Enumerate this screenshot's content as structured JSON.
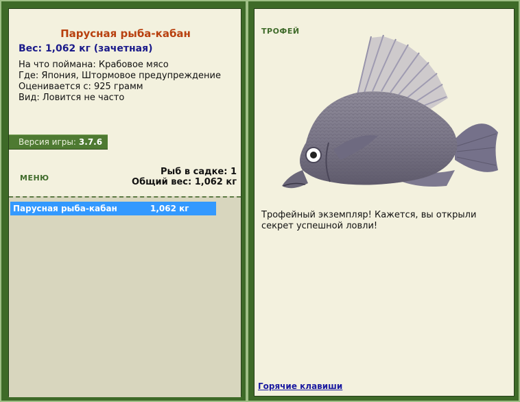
{
  "fish": {
    "title": "Парусная рыба-кабан",
    "weight_line": "Вес: 1,062 кг (зачетная)",
    "bait": "На что поймана: Крабовое мясо",
    "location": "Где: Япония, Штормовое предупреждение",
    "rated_from": "Оценивается с: 925 грамм",
    "species_note": "Вид: Ловится не часто"
  },
  "version": {
    "label": "Версия игры:",
    "value": "3.7.6"
  },
  "menu": {
    "label": "МЕНЮ"
  },
  "stats": {
    "fish_count": "Рыб в садке: 1",
    "total_weight": "Общий вес: 1,062 кг"
  },
  "keepnet": {
    "items": [
      {
        "name": "Парусная рыба-кабан",
        "weight": "1,062 кг"
      }
    ]
  },
  "trophy": {
    "label": "ТРОФЕЙ",
    "text": "Трофейный экземпляр! Кажется, вы открыли секрет успешной ловли!"
  },
  "hotkeys": {
    "label": "Горячие клавиши"
  },
  "colors": {
    "frame_green": "#3e6a28",
    "panel_bg": "#f3f1de",
    "title_orange": "#b8400e",
    "weight_blue": "#1a1a8a",
    "selection_blue": "#3399ff"
  }
}
